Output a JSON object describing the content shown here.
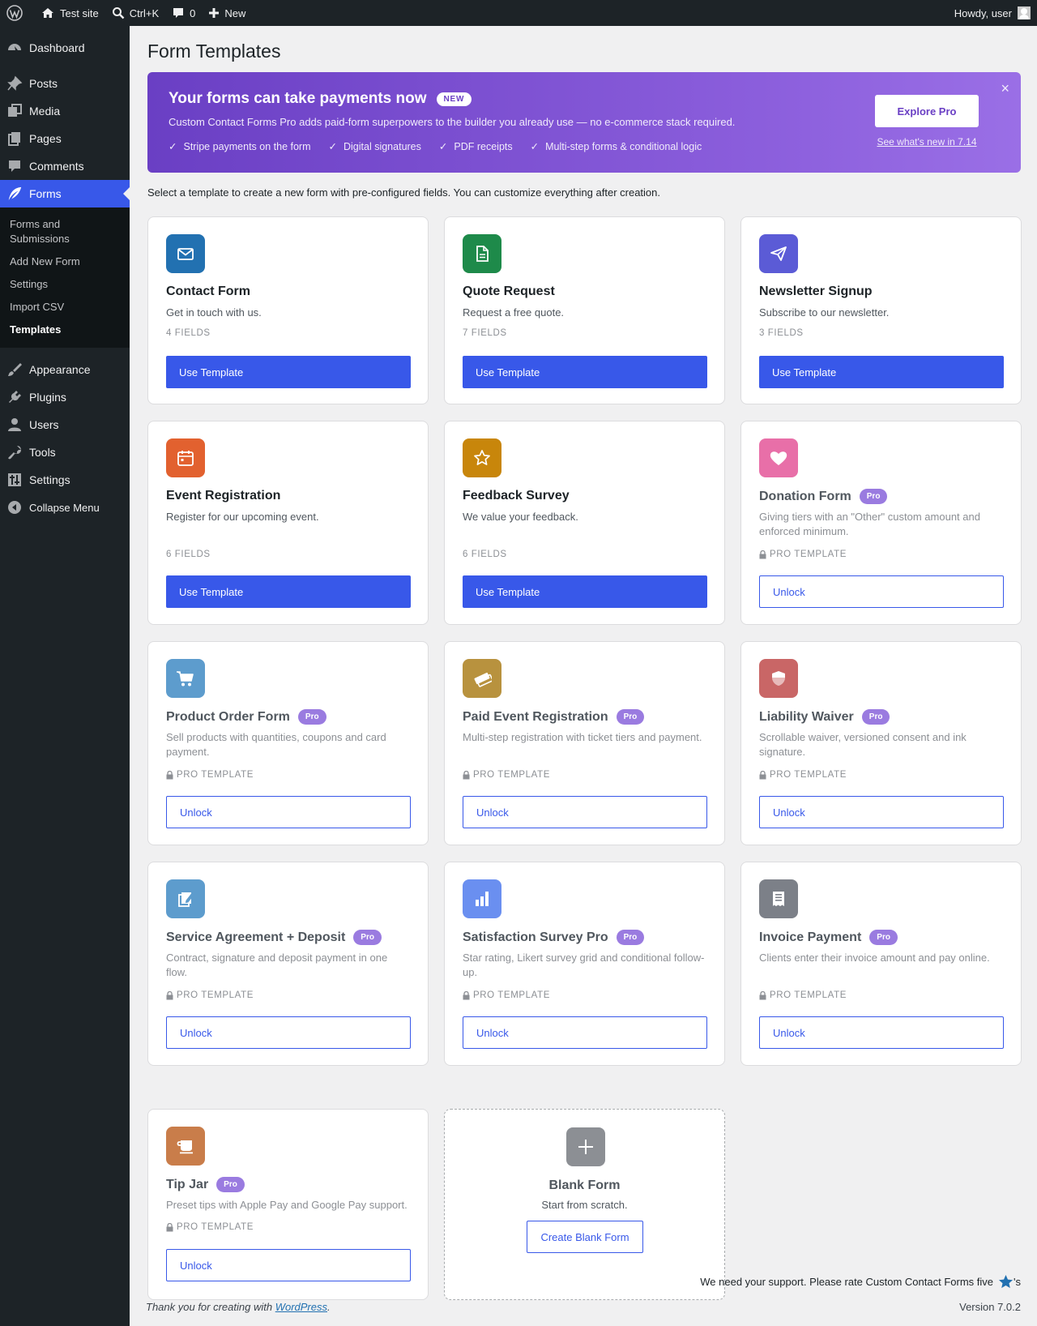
{
  "adminbar": {
    "site_name": "Test site",
    "search_shortcut": "Ctrl+K",
    "comments_count": "0",
    "new_label": "New",
    "howdy": "Howdy, user"
  },
  "sidebar": {
    "items": [
      {
        "label": "Dashboard",
        "icon": "dashboard-icon"
      },
      {
        "label": "Posts",
        "icon": "pushpin-icon"
      },
      {
        "label": "Media",
        "icon": "media-icon"
      },
      {
        "label": "Pages",
        "icon": "pages-icon"
      },
      {
        "label": "Comments",
        "icon": "comment-icon"
      },
      {
        "label": "Forms",
        "icon": "feather-icon"
      },
      {
        "label": "Appearance",
        "icon": "brush-icon"
      },
      {
        "label": "Plugins",
        "icon": "plug-icon"
      },
      {
        "label": "Users",
        "icon": "user-icon"
      },
      {
        "label": "Tools",
        "icon": "wrench-icon"
      },
      {
        "label": "Settings",
        "icon": "settings-icon"
      },
      {
        "label": "Collapse Menu",
        "icon": "collapse-icon"
      }
    ],
    "forms_submenu": [
      "Forms and Submissions",
      "Add New Form",
      "Settings",
      "Import CSV",
      "Templates"
    ]
  },
  "page": {
    "title": "Form Templates",
    "intro": "Select a template to create a new form with pre-configured fields. You can customize everything after creation."
  },
  "promo": {
    "title": "Your forms can take payments now",
    "badge": "NEW",
    "description": "Custom Contact Forms Pro adds paid-form superpowers to the builder you already use — no e-commerce stack required.",
    "features": [
      "Stripe payments on the form",
      "Digital signatures",
      "PDF receipts",
      "Multi-step forms & conditional logic"
    ],
    "check_glyph": "✓",
    "cta": "Explore Pro",
    "link": "See what's new in 7.14",
    "close": "×"
  },
  "templates": [
    {
      "name": "Contact Form",
      "description": "Get in touch with us.",
      "meta": "4 FIELDS",
      "button": "Use Template",
      "icon": "envelope-icon",
      "color": "#2271b1"
    },
    {
      "name": "Quote Request",
      "description": "Request a free quote.",
      "meta": "7 FIELDS",
      "button": "Use Template",
      "icon": "document-icon",
      "color": "#1e8a4a"
    },
    {
      "name": "Newsletter Signup",
      "description": "Subscribe to our newsletter.",
      "meta": "3 FIELDS",
      "button": "Use Template",
      "icon": "paper-plane-icon",
      "color": "#5b5bd6"
    },
    {
      "name": "Event Registration",
      "description": "Register for our upcoming event.",
      "meta": "6 FIELDS",
      "button": "Use Template",
      "icon": "calendar-icon",
      "color": "#e2612f"
    },
    {
      "name": "Feedback Survey",
      "description": "We value your feedback.",
      "meta": "6 FIELDS",
      "button": "Use Template",
      "icon": "star-icon",
      "color": "#c8860b"
    },
    {
      "name": "Donation Form",
      "badge": "Pro",
      "description": "Giving tiers with an \"Other\" custom amount and enforced minimum.",
      "meta": "PRO TEMPLATE",
      "button": "Unlock",
      "icon": "heart-icon",
      "color": "#e86fa8"
    },
    {
      "name": "Product Order Form",
      "badge": "Pro",
      "description": "Sell products with quantities, coupons and card payment.",
      "meta": "PRO TEMPLATE",
      "button": "Unlock",
      "icon": "cart-icon",
      "color": "#5d9ccd"
    },
    {
      "name": "Paid Event Registration",
      "badge": "Pro",
      "description": "Multi-step registration with ticket tiers and payment.",
      "meta": "PRO TEMPLATE",
      "button": "Unlock",
      "icon": "tickets-icon",
      "color": "#b8923e"
    },
    {
      "name": "Liability Waiver",
      "badge": "Pro",
      "description": "Scrollable waiver, versioned consent and ink signature.",
      "meta": "PRO TEMPLATE",
      "button": "Unlock",
      "icon": "shield-icon",
      "color": "#c96666"
    },
    {
      "name": "Service Agreement + Deposit",
      "badge": "Pro",
      "description": "Contract, signature and deposit payment in one flow.",
      "meta": "PRO TEMPLATE",
      "button": "Unlock",
      "icon": "edit-document-icon",
      "color": "#5d9ccd"
    },
    {
      "name": "Satisfaction Survey Pro",
      "badge": "Pro",
      "description": "Star rating, Likert survey grid and conditional follow-up.",
      "meta": "PRO TEMPLATE",
      "button": "Unlock",
      "icon": "bar-chart-icon",
      "color": "#6a8ff0"
    },
    {
      "name": "Invoice Payment",
      "badge": "Pro",
      "description": "Clients enter their invoice amount and pay online.",
      "meta": "PRO TEMPLATE",
      "button": "Unlock",
      "icon": "invoice-icon",
      "color": "#7c8088"
    },
    {
      "name": "Tip Jar",
      "badge": "Pro",
      "description": "Preset tips with Apple Pay and Google Pay support.",
      "meta": "PRO TEMPLATE",
      "button": "Unlock",
      "icon": "coffee-icon",
      "color": "#c97d4a"
    }
  ],
  "blank": {
    "title": "Blank Form",
    "description": "Start from scratch.",
    "button": "Create Blank Form"
  },
  "footer": {
    "support": "We need your support. Please rate Custom Contact Forms five",
    "support_suffix": "'s",
    "thanks_prefix": "Thank you for creating with ",
    "thanks_link": "WordPress",
    "thanks_suffix": ".",
    "version": "Version 7.0.2"
  }
}
